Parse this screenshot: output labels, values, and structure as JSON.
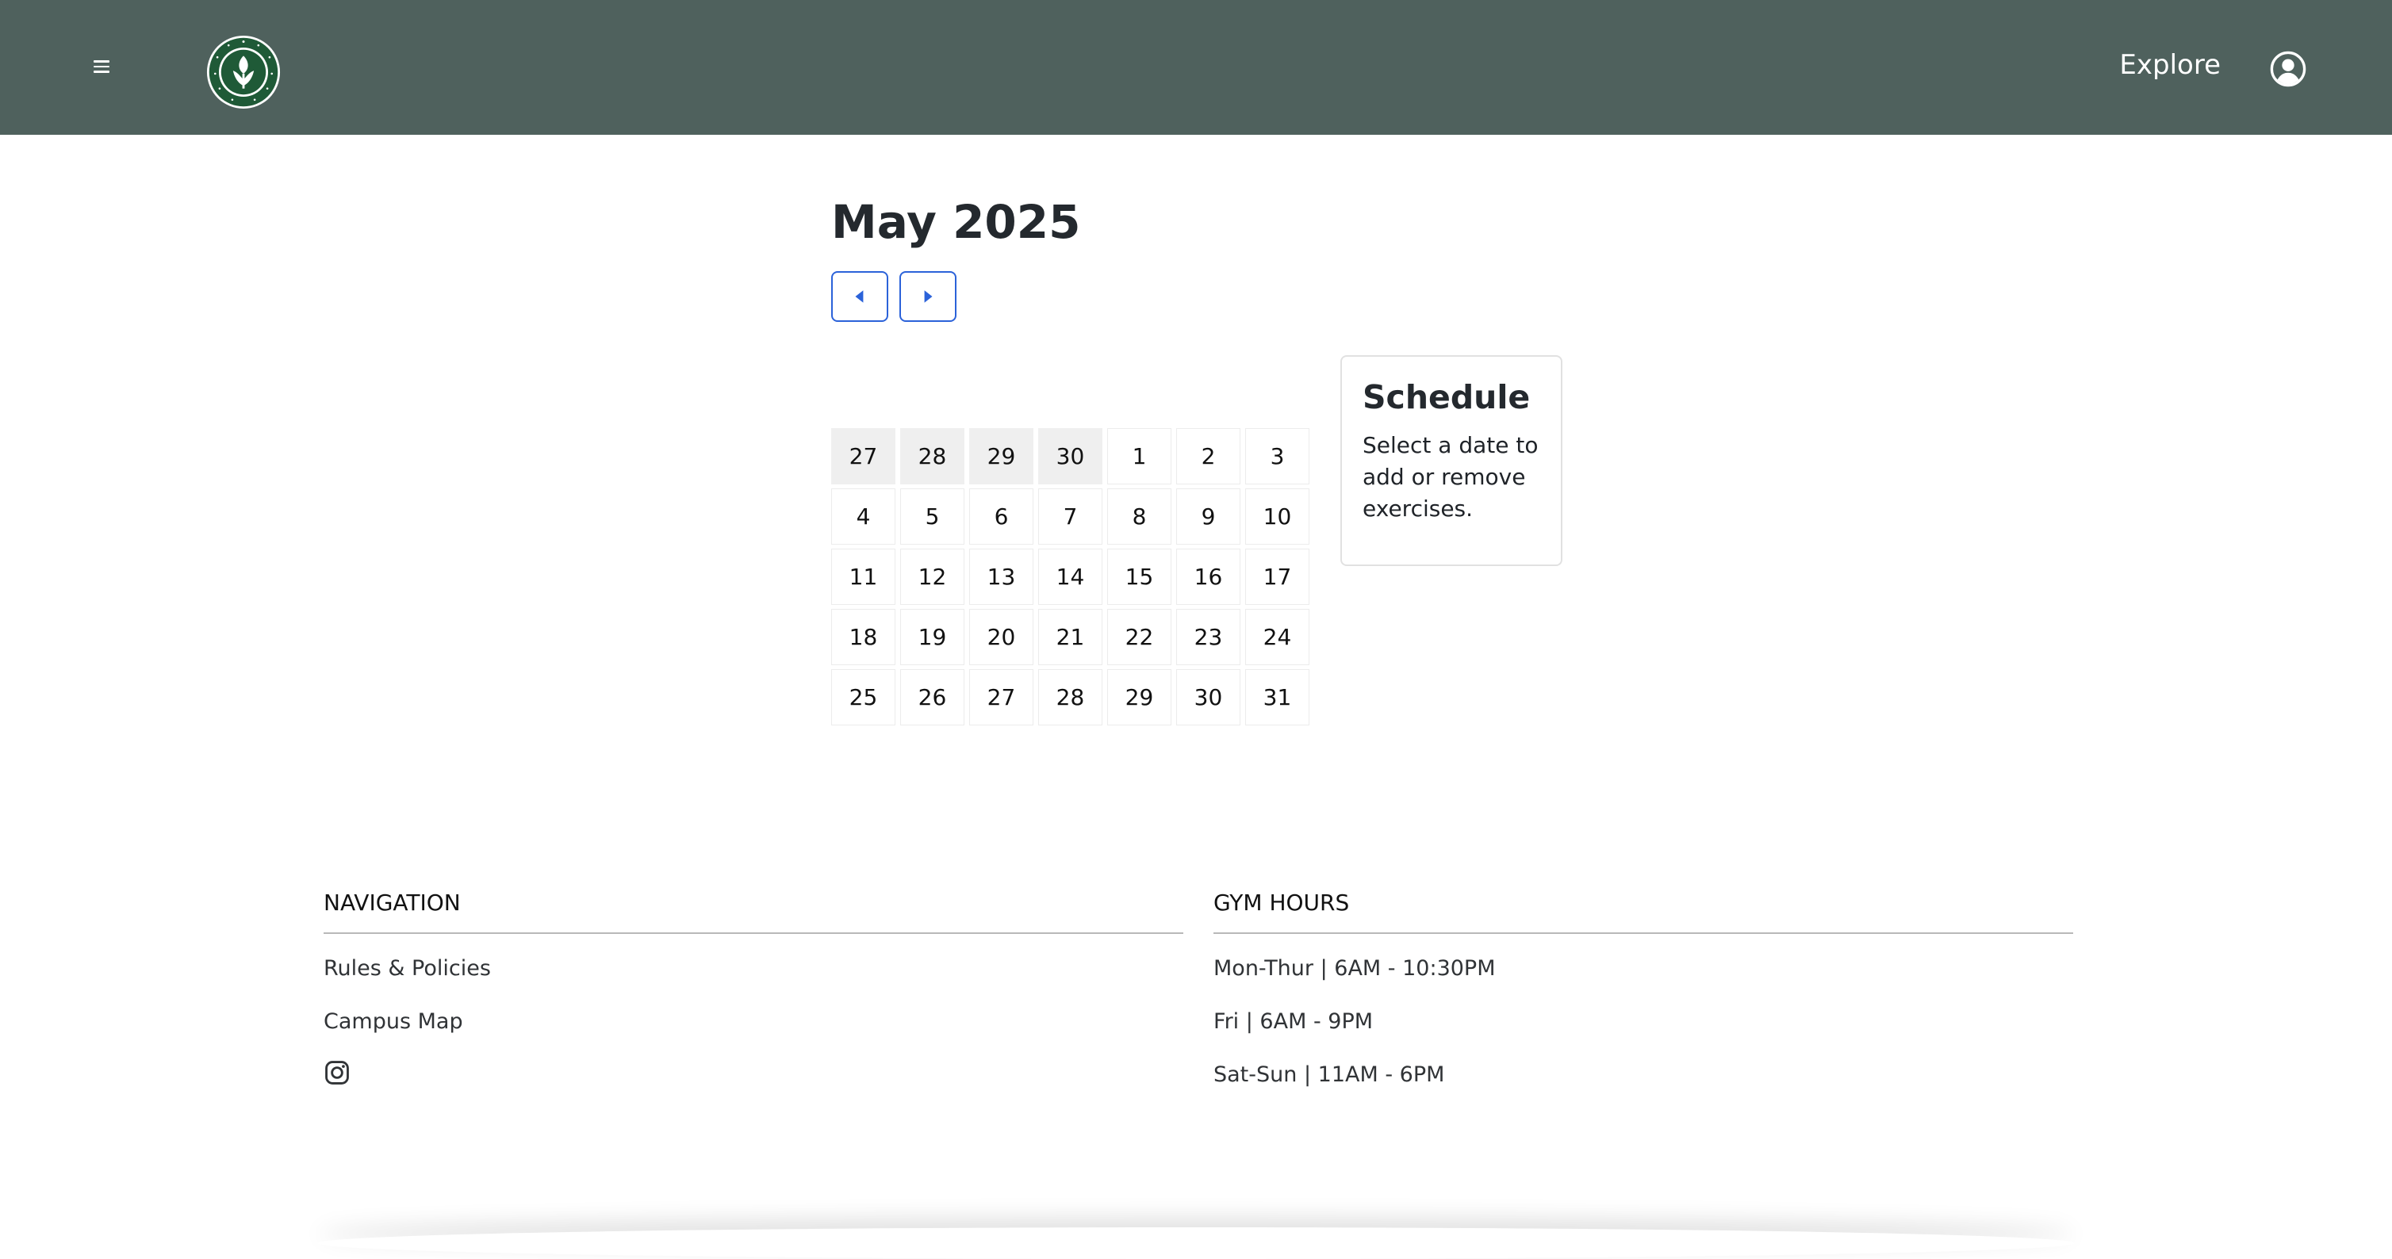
{
  "header": {
    "explore_label": "Explore",
    "icons": [
      "menu-icon",
      "university-seal-logo",
      "user-circle-icon"
    ],
    "background_color": "#4f615d"
  },
  "calendar": {
    "month_label": "May 2025",
    "prev_icon": "caret-left-icon",
    "next_icon": "caret-right-icon",
    "accent_color": "#2b62d9",
    "days": [
      {
        "label": "27",
        "muted": true
      },
      {
        "label": "28",
        "muted": true
      },
      {
        "label": "29",
        "muted": true
      },
      {
        "label": "30",
        "muted": true
      },
      {
        "label": "1",
        "muted": false
      },
      {
        "label": "2",
        "muted": false
      },
      {
        "label": "3",
        "muted": false
      },
      {
        "label": "4",
        "muted": false
      },
      {
        "label": "5",
        "muted": false
      },
      {
        "label": "6",
        "muted": false
      },
      {
        "label": "7",
        "muted": false
      },
      {
        "label": "8",
        "muted": false
      },
      {
        "label": "9",
        "muted": false
      },
      {
        "label": "10",
        "muted": false
      },
      {
        "label": "11",
        "muted": false
      },
      {
        "label": "12",
        "muted": false
      },
      {
        "label": "13",
        "muted": false
      },
      {
        "label": "14",
        "muted": false
      },
      {
        "label": "15",
        "muted": false
      },
      {
        "label": "16",
        "muted": false
      },
      {
        "label": "17",
        "muted": false
      },
      {
        "label": "18",
        "muted": false
      },
      {
        "label": "19",
        "muted": false
      },
      {
        "label": "20",
        "muted": false
      },
      {
        "label": "21",
        "muted": false
      },
      {
        "label": "22",
        "muted": false
      },
      {
        "label": "23",
        "muted": false
      },
      {
        "label": "24",
        "muted": false
      },
      {
        "label": "25",
        "muted": false
      },
      {
        "label": "26",
        "muted": false
      },
      {
        "label": "27",
        "muted": false
      },
      {
        "label": "28",
        "muted": false
      },
      {
        "label": "29",
        "muted": false
      },
      {
        "label": "30",
        "muted": false
      },
      {
        "label": "31",
        "muted": false
      }
    ]
  },
  "schedule": {
    "title": "Schedule",
    "text": "Select a date to add or remove exercises."
  },
  "footer": {
    "navigation": {
      "heading": "NAVIGATION",
      "links": [
        "Rules & Policies",
        "Campus Map"
      ],
      "social_icon": "instagram-icon"
    },
    "gym_hours": {
      "heading": "GYM HOURS",
      "hours": [
        "Mon-Thur | 6AM - 10:30PM",
        "Fri | 6AM - 9PM",
        "Sat-Sun | 11AM - 6PM"
      ]
    }
  }
}
